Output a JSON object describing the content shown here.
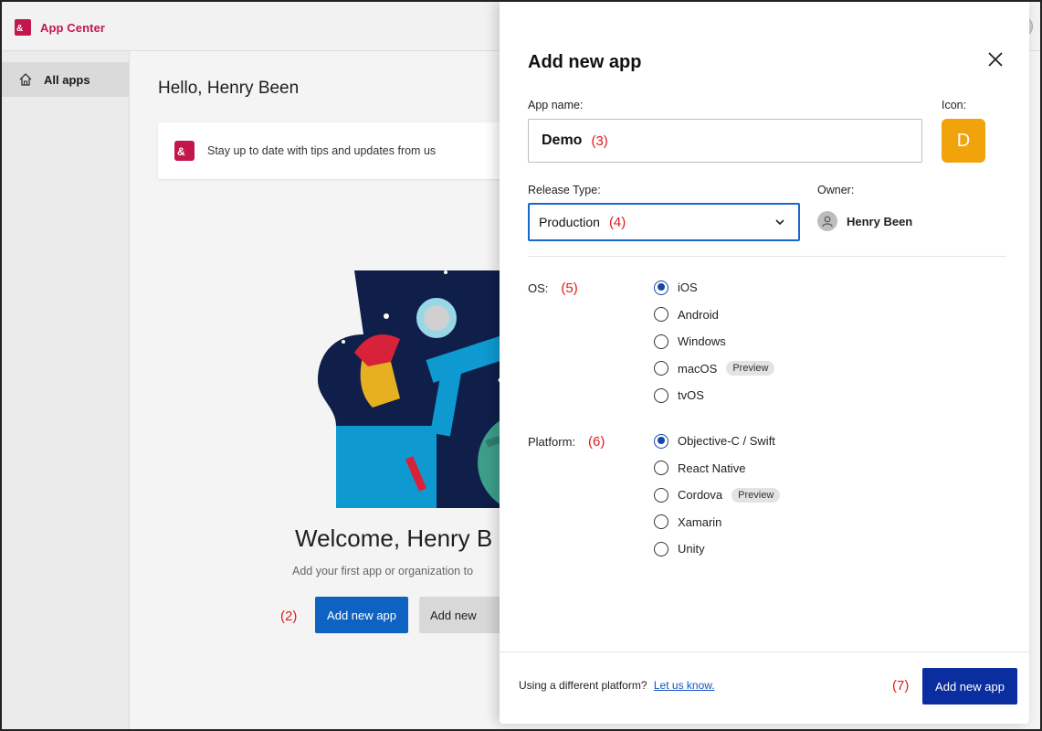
{
  "app": {
    "brand": "App Center",
    "brand_color": "#c1174b",
    "logo_icon": "app-center-logo-icon"
  },
  "sidebar": {
    "items": [
      {
        "label": "All apps",
        "icon": "home-icon",
        "selected": true
      }
    ]
  },
  "main": {
    "greeting": "Hello, Henry Been",
    "tips_text": "Stay up to date with tips and updates from us",
    "welcome_title": "Welcome, Henry B",
    "welcome_sub": "Add your first app or organization to",
    "annotation_2": "(2)",
    "add_app_button": "Add new app",
    "add_new_button": "Add new"
  },
  "modal": {
    "title": "Add new app",
    "app_name_label": "App name:",
    "app_name_value": "Demo",
    "annotation_3": "(3)",
    "icon_label": "Icon:",
    "icon_letter": "D",
    "icon_color": "#f0a30a",
    "release_type_label": "Release Type:",
    "release_type_value": "Production",
    "annotation_4": "(4)",
    "owner_label": "Owner:",
    "owner_name": "Henry Been",
    "os_label": "OS:",
    "annotation_5": "(5)",
    "os_options": [
      {
        "label": "iOS",
        "selected": true
      },
      {
        "label": "Android",
        "selected": false
      },
      {
        "label": "Windows",
        "selected": false
      },
      {
        "label": "macOS",
        "selected": false,
        "badge": "Preview"
      },
      {
        "label": "tvOS",
        "selected": false
      }
    ],
    "platform_label": "Platform:",
    "annotation_6": "(6)",
    "platform_options": [
      {
        "label": "Objective-C / Swift",
        "selected": true
      },
      {
        "label": "React Native",
        "selected": false
      },
      {
        "label": "Cordova",
        "selected": false,
        "badge": "Preview"
      },
      {
        "label": "Xamarin",
        "selected": false
      },
      {
        "label": "Unity",
        "selected": false
      }
    ],
    "footer_text": "Using a different platform?",
    "footer_link": "Let us know.",
    "annotation_7": "(7)",
    "submit_button": "Add new app",
    "accent_color": "#0a2ea0"
  }
}
